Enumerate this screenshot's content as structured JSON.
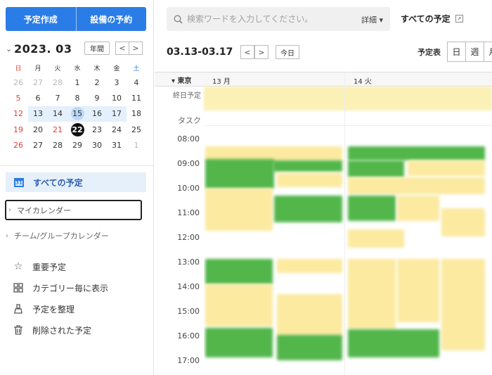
{
  "sidebar": {
    "create_button": "予定作成",
    "facility_button": "設備の予約",
    "month_title": "2023. 03",
    "year_button": "年間",
    "nav_prev": "<",
    "nav_next": ">",
    "weekdays": [
      "日",
      "月",
      "火",
      "水",
      "木",
      "金",
      "土"
    ],
    "weeks": [
      [
        "26",
        "27",
        "28",
        "1",
        "2",
        "3",
        "4"
      ],
      [
        "5",
        "6",
        "7",
        "8",
        "9",
        "10",
        "11"
      ],
      [
        "12",
        "13",
        "14",
        "15",
        "16",
        "17",
        "18"
      ],
      [
        "19",
        "20",
        "21",
        "22",
        "23",
        "24",
        "25"
      ],
      [
        "26",
        "27",
        "28",
        "29",
        "30",
        "31",
        "1"
      ]
    ],
    "all_events": "すべての予定",
    "all_events_icon_text": "31",
    "my_calendar": "マイカレンダー",
    "team_calendar": "チーム/グループカレンダー",
    "menu": [
      {
        "label": "重要予定",
        "icon": "star-icon"
      },
      {
        "label": "カテゴリー毎に表示",
        "icon": "grid-icon"
      },
      {
        "label": "予定を整理",
        "icon": "broom-icon"
      },
      {
        "label": "削除された予定",
        "icon": "trash-icon"
      }
    ]
  },
  "search": {
    "placeholder": "検索ワードを入力してください。",
    "detail_label": "詳細",
    "detail_caret": "▾"
  },
  "header": {
    "title": "すべての予定",
    "range": "03.13-03.17",
    "today_button": "今日",
    "view_label": "予定表",
    "views": [
      "日",
      "週",
      "月"
    ]
  },
  "grid": {
    "timezone": "東京",
    "days": [
      "13 月",
      "14 火"
    ],
    "allday_label": "終日予定",
    "task_label": "タスク",
    "hours": [
      "08:00",
      "09:00",
      "10:00",
      "11:00",
      "12:00",
      "13:00",
      "14:00",
      "15:00",
      "16:00",
      "17:00"
    ]
  },
  "colors": {
    "primary": "#2a7de6",
    "event_yellow": "#fbeaa0",
    "event_green": "#52b64b",
    "highlight": "#e4f0fb"
  }
}
